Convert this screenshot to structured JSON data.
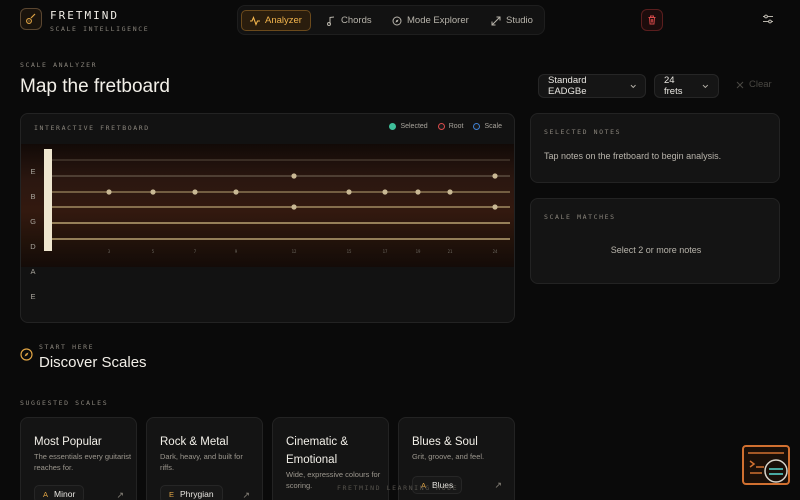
{
  "brand": {
    "name": "FRETMIND",
    "tagline": "SCALE INTELLIGENCE"
  },
  "nav": [
    {
      "label": "Analyzer",
      "icon": "waveform-icon",
      "active": true
    },
    {
      "label": "Chords",
      "icon": "music-note-icon",
      "active": false
    },
    {
      "label": "Mode Explorer",
      "icon": "compass-icon",
      "active": false
    },
    {
      "label": "Studio",
      "icon": "expand-icon",
      "active": false
    }
  ],
  "header_actions": {
    "trash_icon": "trash-icon",
    "settings_icon": "sliders-icon"
  },
  "page": {
    "eyebrow": "SCALE ANALYZER",
    "title": "Map the fretboard"
  },
  "controls": {
    "tuning": "Standard EADGBe",
    "frets": "24 frets",
    "clear": "Clear"
  },
  "fretboard": {
    "title": "INTERACTIVE FRETBOARD",
    "legend": [
      {
        "label": "Selected",
        "color": "#3fbf9a"
      },
      {
        "label": "Root",
        "color": "#d94a4a"
      },
      {
        "label": "Scale",
        "color": "#3f7fd0"
      }
    ],
    "strings": [
      "E",
      "B",
      "G",
      "D",
      "A",
      "E"
    ],
    "fret_numbers": [
      "3",
      "5",
      "7",
      "9",
      "12",
      "15",
      "17",
      "19",
      "21",
      "24"
    ]
  },
  "selected_notes": {
    "title": "SELECTED NOTES",
    "message": "Tap notes on the fretboard to begin analysis."
  },
  "scale_matches": {
    "title": "SCALE MATCHES",
    "message": "Select 2 or more notes"
  },
  "discover": {
    "eyebrow": "START HERE",
    "title": "Discover Scales",
    "suggested_label": "SUGGESTED SCALES"
  },
  "scale_cards": [
    {
      "title": "Most Popular",
      "desc": "The essentials every guitarist reaches for.",
      "root": "A",
      "scale": "Minor"
    },
    {
      "title": "Rock & Metal",
      "desc": "Dark, heavy, and built for riffs.",
      "root": "E",
      "scale": "Phrygian"
    },
    {
      "title": "Cinematic & Emotional",
      "desc": "Wide, expressive colours for scoring.",
      "root": "",
      "scale": ""
    },
    {
      "title": "Blues & Soul",
      "desc": "Grit, groove, and feel.",
      "root": "A",
      "scale": "Blues"
    }
  ],
  "footer": "FRETMIND LEARNING MODE",
  "colors": {
    "accent": "#f2b44c",
    "danger": "#d94a4a",
    "background": "#0a0a0a"
  }
}
